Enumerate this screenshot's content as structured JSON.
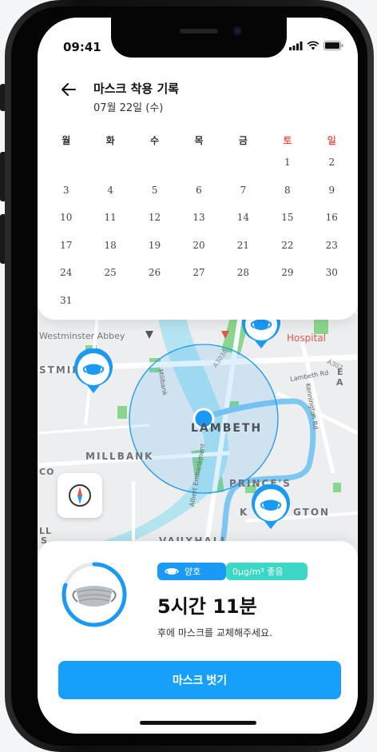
{
  "status_bar": {
    "time": "09:41"
  },
  "header": {
    "title": "마스크 착용 기록",
    "date": "07월 22일 (수)"
  },
  "calendar": {
    "weekdays": [
      "월",
      "화",
      "수",
      "목",
      "금",
      "토",
      "일"
    ],
    "weeks": [
      [
        "",
        "",
        "",
        "",
        "",
        "1",
        "2"
      ],
      [
        "3",
        "4",
        "5",
        "6",
        "7",
        "8",
        "9"
      ],
      [
        "10",
        "11",
        "12",
        "13",
        "14",
        "15",
        "16"
      ],
      [
        "17",
        "18",
        "19",
        "20",
        "21",
        "22",
        "23"
      ],
      [
        "24",
        "25",
        "26",
        "27",
        "28",
        "29",
        "30"
      ],
      [
        "31",
        "",
        "",
        "",
        "",
        "",
        ""
      ]
    ],
    "weekend_color": "#e9584c"
  },
  "map": {
    "labels": {
      "westminster": "STMIN",
      "lambeth": "LAMBETH",
      "millbank": "MILLBANK",
      "princes": "PRINCE'S",
      "kennington_a": "K",
      "kennington_b": "GTON",
      "vauxhall": "VAUXHALL",
      "hospital": "Hospital",
      "abbey": "Westminster Abbey",
      "co": "CO",
      "ll": "LL",
      "s": "S",
      "road_a3036": "A3036",
      "road_a302": "A302",
      "road_lambeth": "Lambeth Rd",
      "road_kennington": "Kennington Rd",
      "road_millbank": "Millbank",
      "road_albert": "Albert Embankment",
      "e": "E",
      "a": "A"
    },
    "accent_color": "#1b9af5",
    "pin_color": "#1b9af5"
  },
  "status_card": {
    "quality_badge": "양호",
    "dust_badge": "0μg/m³ 좋음",
    "remaining": "5시간 11분",
    "description": "후에 마스크를 교체해주세요.",
    "button_label": "마스크 벗기",
    "button_color": "#17a0fb",
    "progress_fraction": 0.8
  }
}
